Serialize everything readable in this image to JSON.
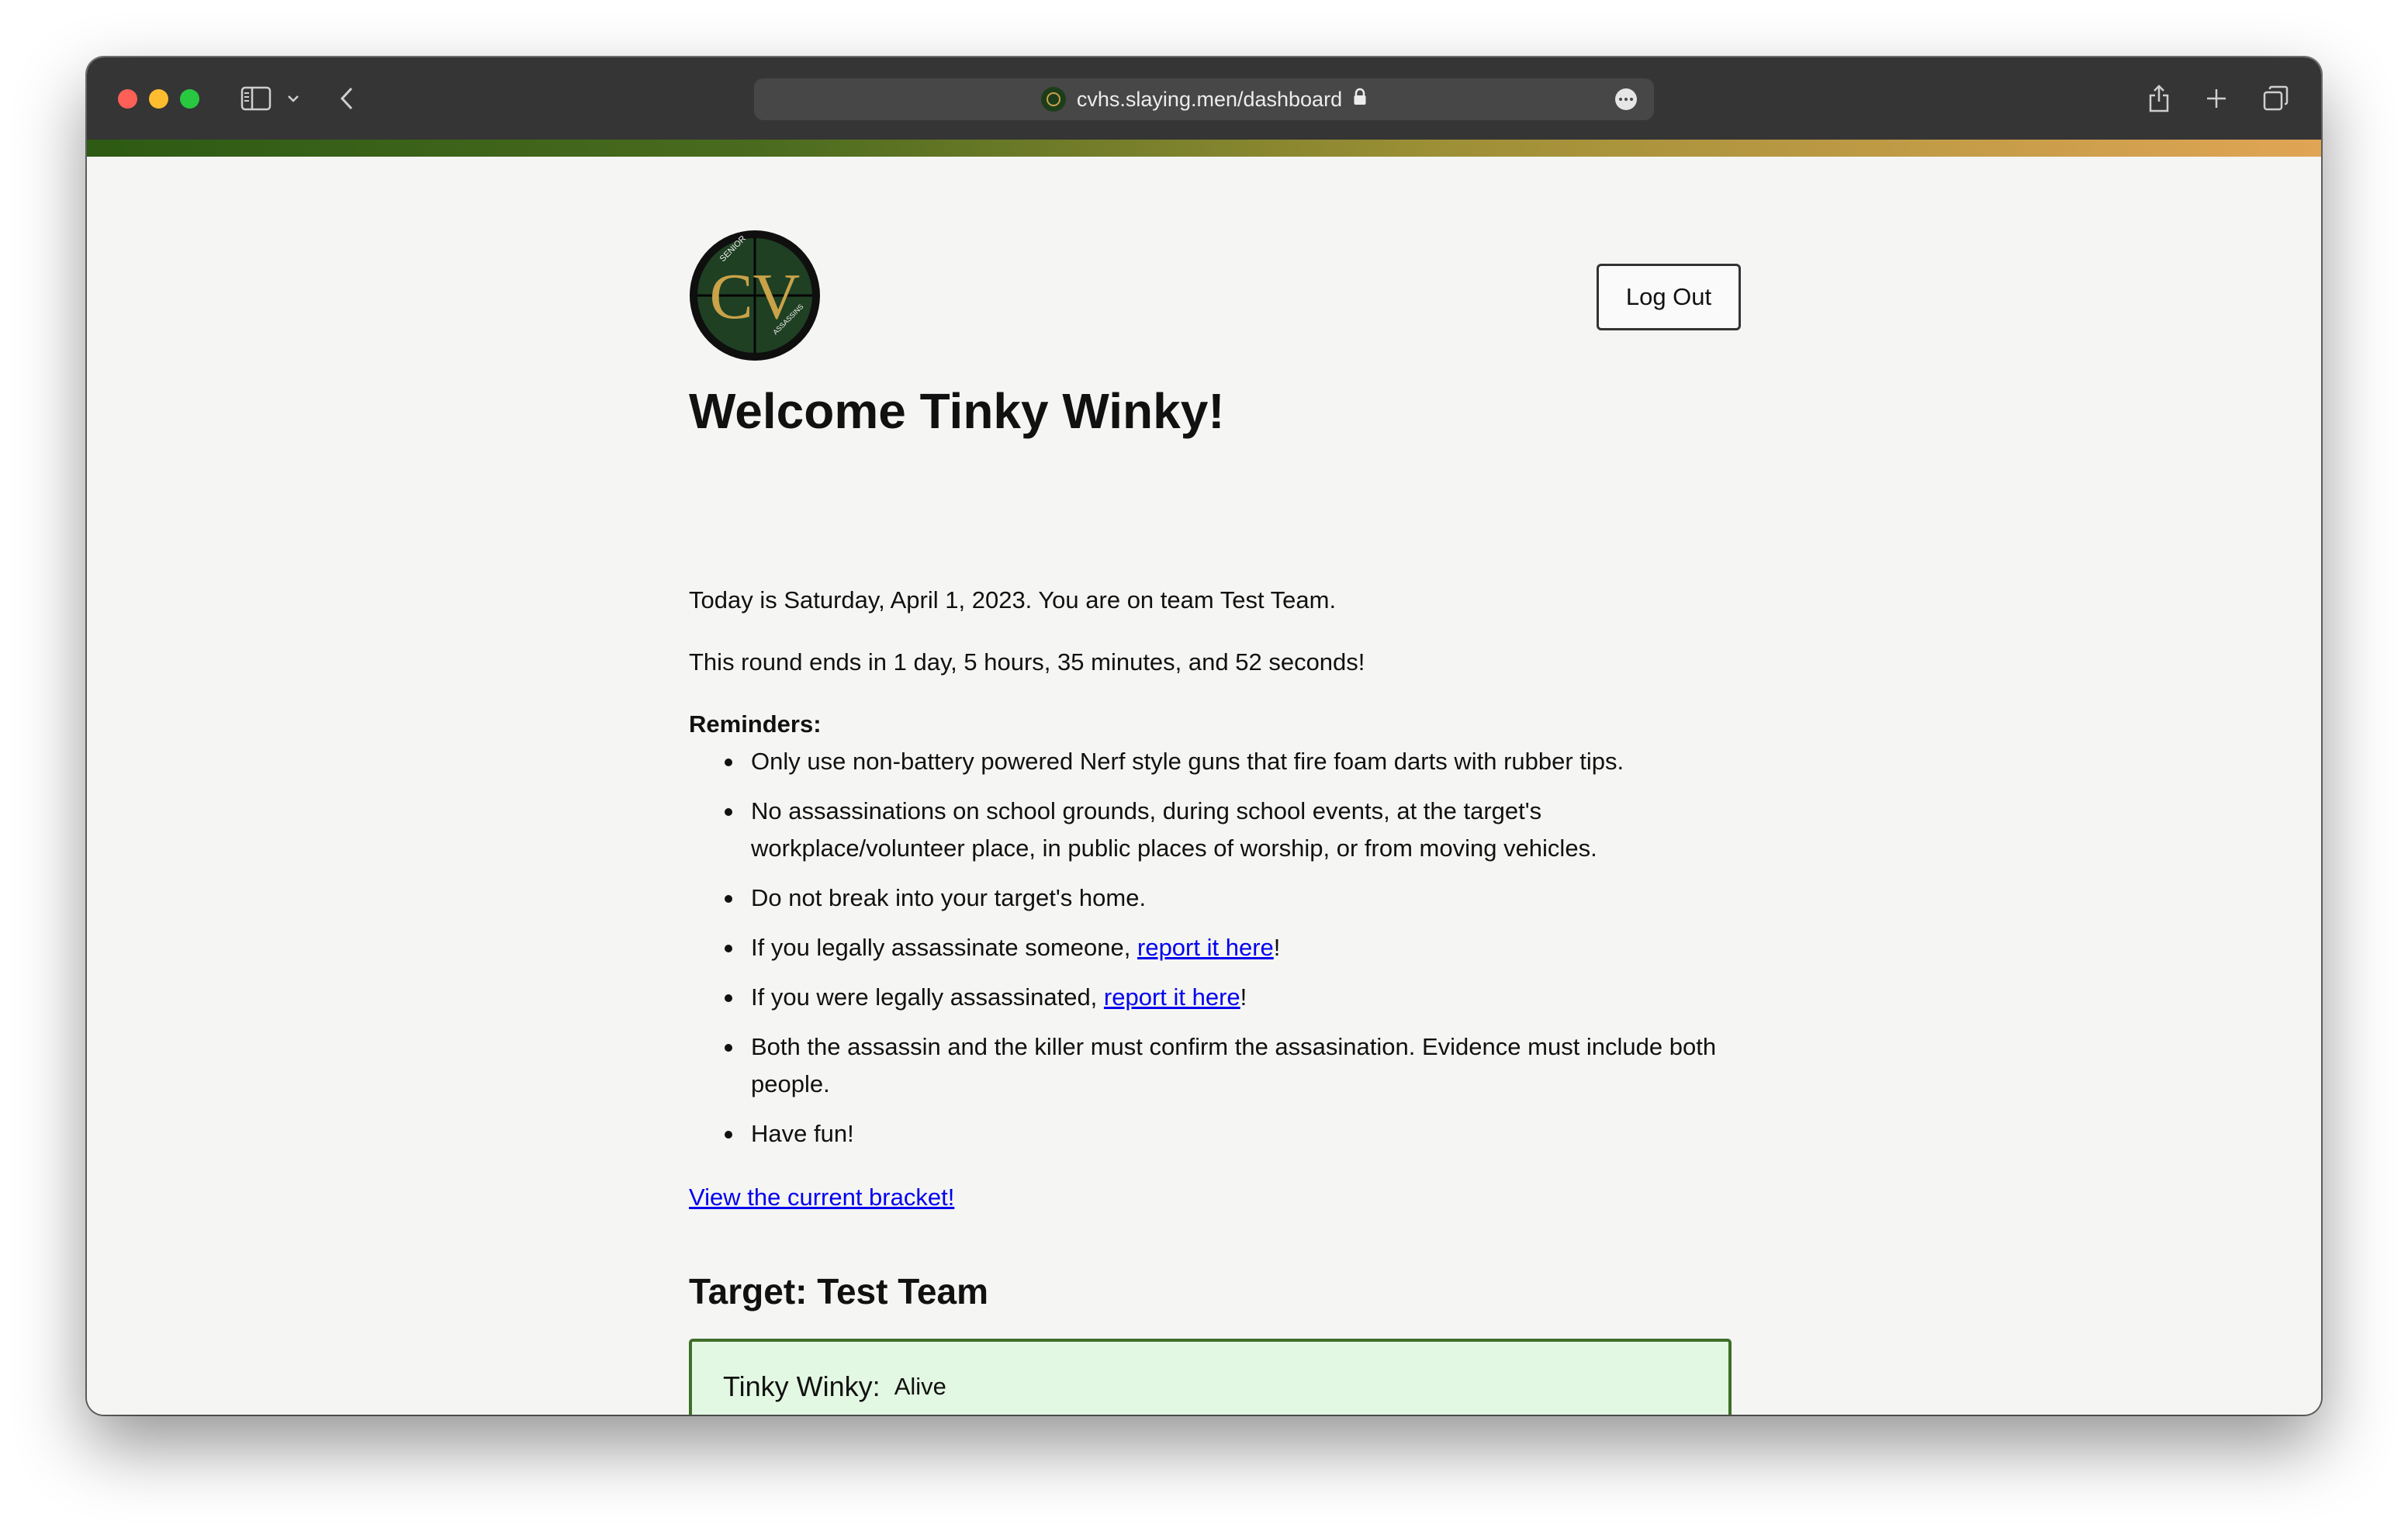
{
  "browser": {
    "url": "cvhs.slaying.men/dashboard"
  },
  "header": {
    "logo_alt_letters": "CV",
    "logo_ring_text_top": "SENIOR",
    "logo_ring_text_bottom": "ASSASSINS",
    "logout_label": "Log Out"
  },
  "welcome": {
    "heading": "Welcome Tinky Winky!",
    "date_line": "Today is Saturday, April 1, 2023. You are on team Test Team.",
    "countdown_line": "This round ends in 1 day, 5 hours, 35 minutes, and 52 seconds!"
  },
  "reminders": {
    "title": "Reminders:",
    "items": [
      "Only use non-battery powered Nerf style guns that fire foam darts with rubber tips.",
      "No assassinations on school grounds, during school events, at the target's workplace/volunteer place, in public places of worship, or from moving vehicles.",
      "Do not break into your target's home.",
      "Both the assassin and the killer must confirm the assasination. Evidence must include both people.",
      "Have fun!"
    ],
    "report_kill_prefix": "If you legally assassinate someone, ",
    "report_kill_link": "report it here",
    "report_kill_suffix": "!",
    "report_death_prefix": "If you were legally assassinated, ",
    "report_death_link": "report it here",
    "report_death_suffix": "!"
  },
  "bracket_link": "View the current bracket!",
  "target": {
    "heading": "Target: Test Team",
    "members": [
      {
        "name": "Tinky Winky:",
        "status": "Alive"
      }
    ]
  },
  "colors": {
    "card_border": "#3f6f2a",
    "card_bg": "#e3f8e3",
    "link": "#0000ee"
  }
}
